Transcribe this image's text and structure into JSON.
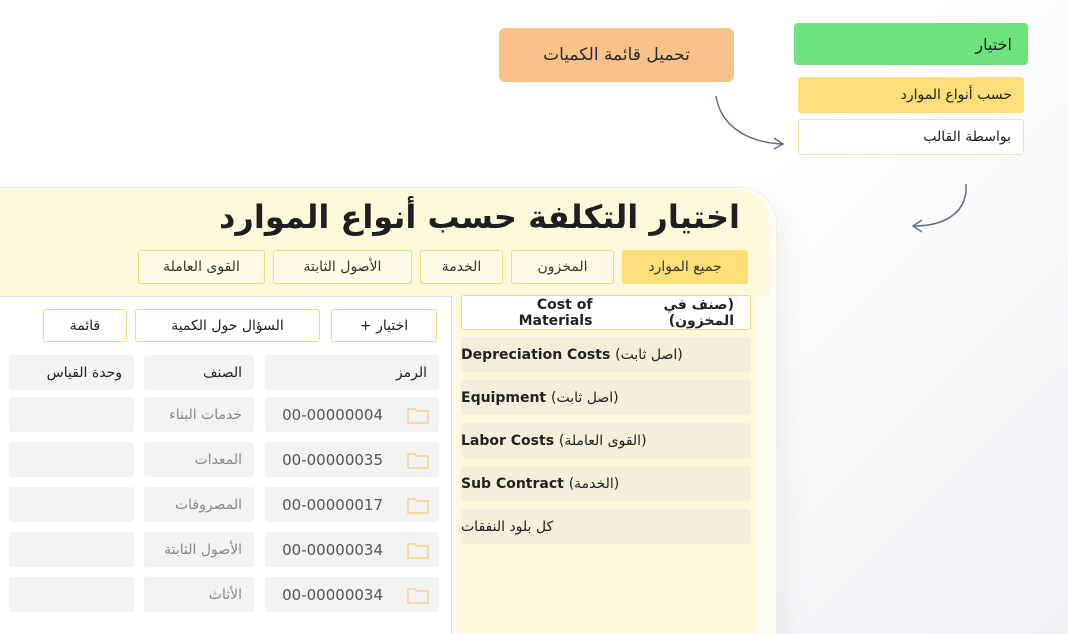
{
  "flow": {
    "load_label": "تحميل قائمة الكميات",
    "select_label": "اختيار",
    "options": [
      "حسب أنواع الموارد",
      "بواسطة القالب"
    ]
  },
  "panel": {
    "title": "اختيار التكلفة حسب أنواع الموارد",
    "tabs": [
      "جميع الموارد",
      "المخزون",
      "الخدمة",
      "الأصول الثابتة",
      "القوى العاملة"
    ],
    "actions": [
      "+ اختيار",
      "السؤال حول الكمية",
      "قائمة"
    ]
  },
  "resources": [
    {
      "ar": "(صنف في المخزون)",
      "en": "Cost of Materials"
    },
    {
      "ar": "(اصل ثابت)",
      "en": "Depreciation Costs"
    },
    {
      "ar": "(اصل ثابت)",
      "en": "Equipment"
    },
    {
      "ar": "(القوى العاملة)",
      "en": "Labor Costs"
    },
    {
      "ar": "(الخدمة)",
      "en": "Sub Contract"
    },
    {
      "ar": "كل بلود النفقات",
      "en": ""
    }
  ],
  "table": {
    "headers": [
      "الرمز",
      "الصنف",
      "وحدة القياس"
    ],
    "rows": [
      {
        "code": "00-00000004",
        "class": "خدمات البناء",
        "unit": ""
      },
      {
        "code": "00-00000035",
        "class": "المعدات",
        "unit": ""
      },
      {
        "code": "00-00000017",
        "class": "المصروفات",
        "unit": ""
      },
      {
        "code": "00-00000034",
        "class": "الأصول الثابتة",
        "unit": ""
      },
      {
        "code": "00-00000034",
        "class": "الأثاث",
        "unit": ""
      }
    ]
  },
  "icons": {
    "folder": "folder-icon"
  },
  "colors": {
    "accent_orange": "#f8c38b",
    "accent_green": "#6ee47f",
    "accent_yellow": "#fddf7a",
    "folder": "#f5d38a"
  }
}
